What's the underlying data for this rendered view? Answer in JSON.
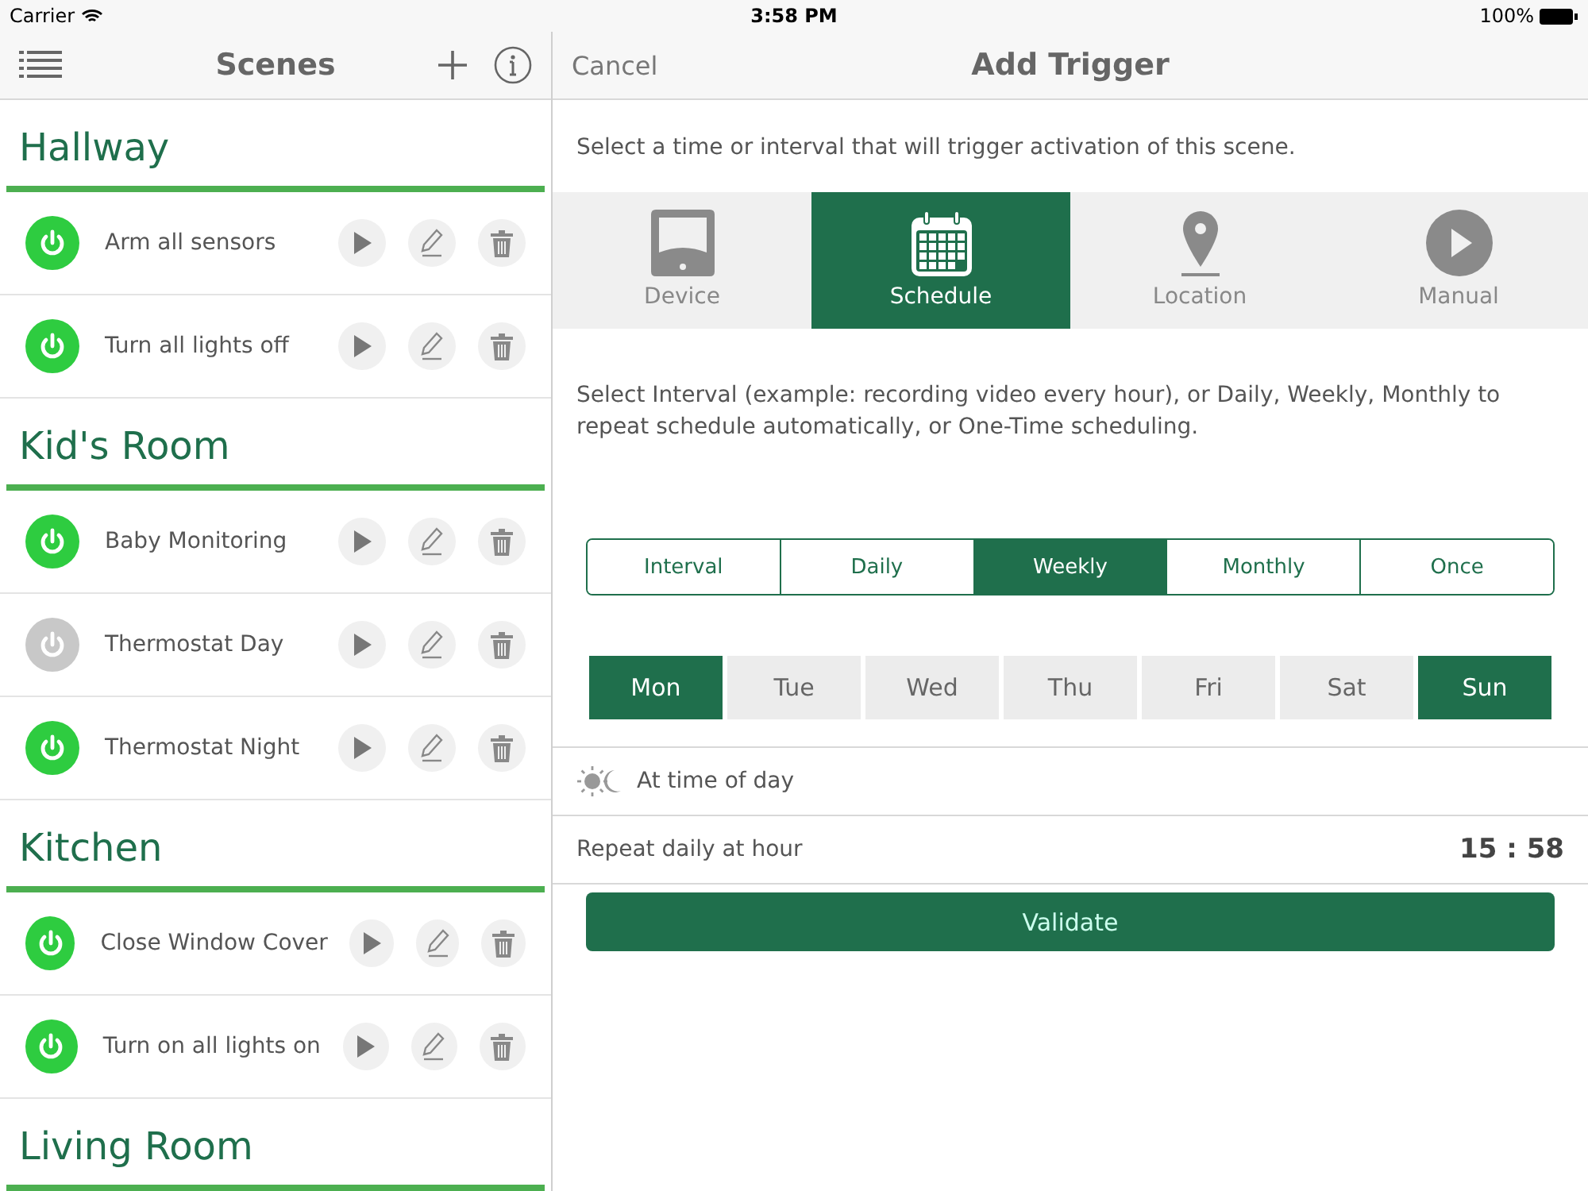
{
  "status_bar": {
    "carrier": "Carrier",
    "time": "3:58 PM",
    "battery": "100%"
  },
  "scenes_panel": {
    "title": "Scenes",
    "groups": [
      {
        "name": "Hallway",
        "scenes": [
          {
            "name": "Arm all sensors",
            "on": true
          },
          {
            "name": "Turn all lights off",
            "on": true
          }
        ]
      },
      {
        "name": "Kid's Room",
        "scenes": [
          {
            "name": "Baby Monitoring",
            "on": true
          },
          {
            "name": "Thermostat Day",
            "on": false
          },
          {
            "name": "Thermostat Night",
            "on": true
          }
        ]
      },
      {
        "name": "Kitchen",
        "scenes": [
          {
            "name": "Close Window Cover",
            "on": true
          },
          {
            "name": "Turn on all lights on",
            "on": true
          }
        ]
      },
      {
        "name": "Living Room"
      }
    ]
  },
  "trigger_panel": {
    "cancel": "Cancel",
    "title": "Add Trigger",
    "intro": "Select a time or interval that will trigger activation of this scene.",
    "trigger_types": [
      {
        "kind": "device",
        "label": "Device",
        "selected": false
      },
      {
        "kind": "schedule",
        "label": "Schedule",
        "selected": true
      },
      {
        "kind": "location",
        "label": "Location",
        "selected": false
      },
      {
        "kind": "manual",
        "label": "Manual",
        "selected": false
      }
    ],
    "interval_text": "Select Interval (example: recording video every hour), or Daily, Weekly, Monthly to repeat schedule automatically, or One-Time scheduling.",
    "frequencies": [
      {
        "label": "Interval",
        "selected": false
      },
      {
        "label": "Daily",
        "selected": false
      },
      {
        "label": "Weekly",
        "selected": true
      },
      {
        "label": "Monthly",
        "selected": false
      },
      {
        "label": "Once",
        "selected": false
      }
    ],
    "days": [
      {
        "label": "Mon",
        "selected": true
      },
      {
        "label": "Tue",
        "selected": false
      },
      {
        "label": "Wed",
        "selected": false
      },
      {
        "label": "Thu",
        "selected": false
      },
      {
        "label": "Fri",
        "selected": false
      },
      {
        "label": "Sat",
        "selected": false
      },
      {
        "label": "Sun",
        "selected": true
      }
    ],
    "time_of_day_label": "At time of day",
    "repeat": {
      "label": "Repeat daily at hour",
      "value": "15 : 58"
    },
    "validate": "Validate"
  }
}
